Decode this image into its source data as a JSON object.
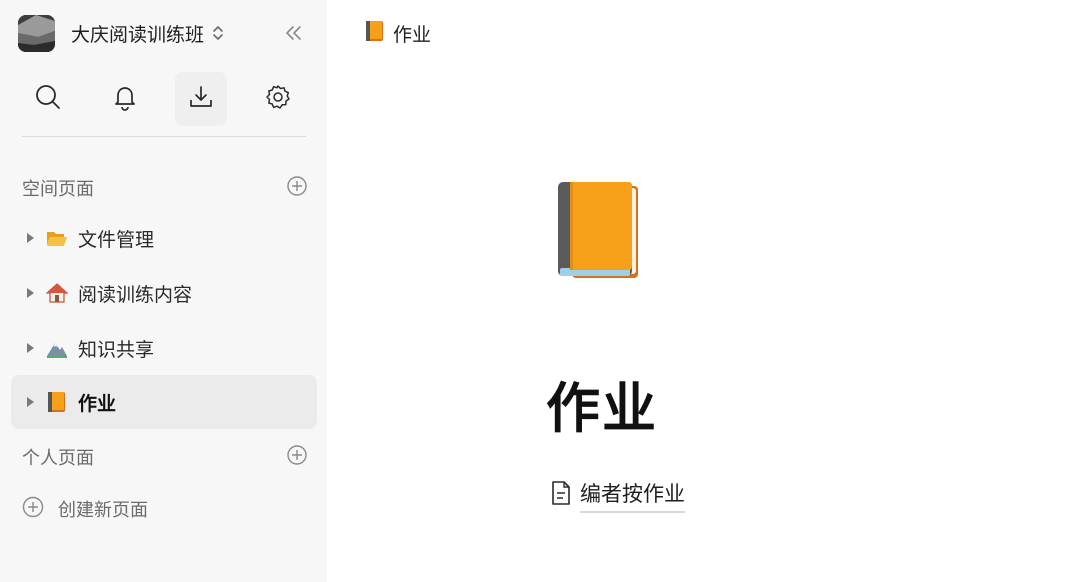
{
  "workspace": {
    "name": "大庆阅读训练班"
  },
  "sidebar": {
    "sections": {
      "space_label": "空间页面",
      "personal_label": "个人页面",
      "create_label": "创建新页面"
    },
    "items": [
      {
        "label": "文件管理",
        "icon": "open-folder-emoji"
      },
      {
        "label": "阅读训练内容",
        "icon": "house-emoji"
      },
      {
        "label": "知识共享",
        "icon": "mountain-emoji"
      },
      {
        "label": "作业",
        "icon": "orange-book-emoji",
        "selected": true
      }
    ]
  },
  "toolbar": {
    "icons": [
      "search-icon",
      "bell-icon",
      "download-icon",
      "gear-icon"
    ]
  },
  "breadcrumb": {
    "label": "作业"
  },
  "page": {
    "title": "作业",
    "subpages": [
      {
        "label": "编者按作业"
      }
    ]
  }
}
